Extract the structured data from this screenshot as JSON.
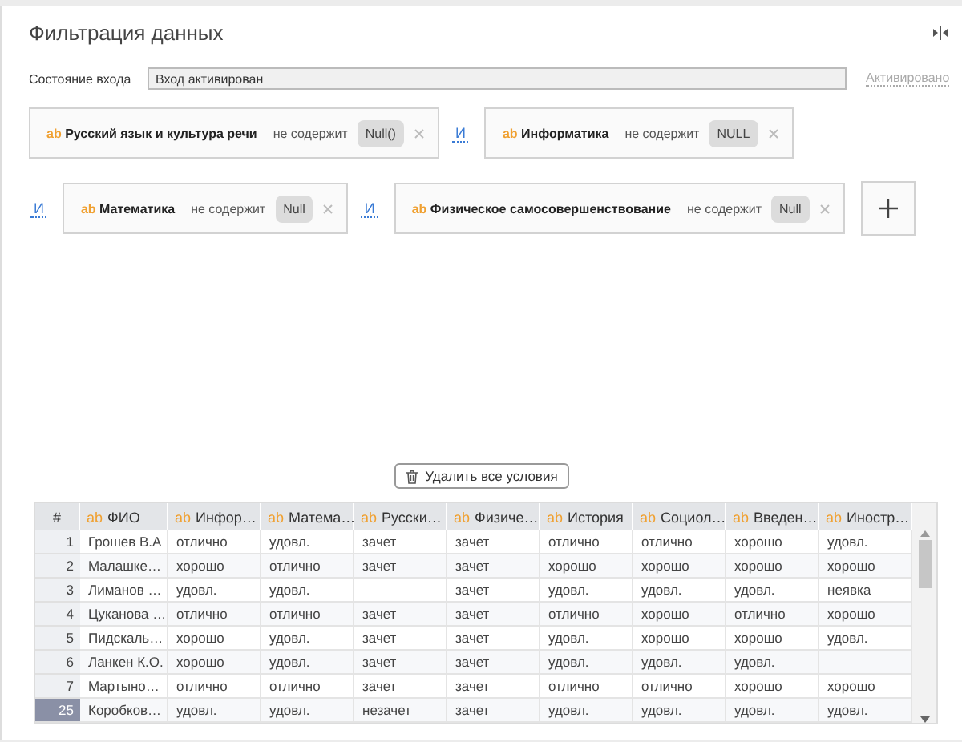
{
  "title": "Фильтрация данных",
  "input_state": {
    "label": "Состояние входа",
    "value": "Вход активирован",
    "status": "Активировано"
  },
  "filter_rows": [
    {
      "items": [
        {
          "type_badge": "ab",
          "field": "Русский язык и культура речи",
          "operator": "не содержит",
          "value": "Null()"
        },
        {
          "connector": "И",
          "type_badge": "ab",
          "field": "Информатика",
          "operator": "не содержит",
          "value": "NULL"
        }
      ]
    },
    {
      "items": [
        {
          "connector": "И",
          "type_badge": "ab",
          "field": "Математика",
          "operator": "не содержит",
          "value": "Null"
        },
        {
          "connector": "И",
          "type_badge": "ab",
          "field": "Физическое самосовершенствование",
          "operator": "не содержит",
          "value": "Null"
        }
      ]
    }
  ],
  "delete_all_button": "Удалить все условия",
  "table": {
    "index_header": "#",
    "columns": [
      {
        "badge": "ab",
        "label": "ФИО"
      },
      {
        "badge": "ab",
        "label": "Инфор…"
      },
      {
        "badge": "ab",
        "label": "Матема…"
      },
      {
        "badge": "ab",
        "label": "Русски…"
      },
      {
        "badge": "ab",
        "label": "Физиче…"
      },
      {
        "badge": "ab",
        "label": "История"
      },
      {
        "badge": "ab",
        "label": "Социол…"
      },
      {
        "badge": "ab",
        "label": "Введен…"
      },
      {
        "badge": "ab",
        "label": "Иностр…"
      }
    ],
    "rows": [
      {
        "index": "1",
        "selected": false,
        "cells": [
          "Грошев В.А",
          "отлично",
          "удовл.",
          "зачет",
          "зачет",
          "отлично",
          "отлично",
          "хорошо",
          "удовл."
        ]
      },
      {
        "index": "2",
        "selected": false,
        "cells": [
          "Малашке…",
          "хорошо",
          "отлично",
          "зачет",
          "зачет",
          "хорошо",
          "хорошо",
          "хорошо",
          "хорошо"
        ]
      },
      {
        "index": "3",
        "selected": false,
        "cells": [
          "Лиманов …",
          "удовл.",
          "удовл.",
          "",
          "зачет",
          "удовл.",
          "удовл.",
          "удовл.",
          "неявка"
        ]
      },
      {
        "index": "4",
        "selected": false,
        "cells": [
          "Цуканова …",
          "отлично",
          "отлично",
          "зачет",
          "зачет",
          "отлично",
          "хорошо",
          "отлично",
          "хорошо"
        ]
      },
      {
        "index": "5",
        "selected": false,
        "cells": [
          "Пидскаль…",
          "хорошо",
          "удовл.",
          "зачет",
          "зачет",
          "удовл.",
          "хорошо",
          "хорошо",
          "удовл."
        ]
      },
      {
        "index": "6",
        "selected": false,
        "cells": [
          "Ланкен К.О.",
          "хорошо",
          "удовл.",
          "зачет",
          "зачет",
          "удовл.",
          "удовл.",
          "удовл.",
          ""
        ]
      },
      {
        "index": "7",
        "selected": false,
        "cells": [
          "Мартыно…",
          "отлично",
          "отлично",
          "зачет",
          "зачет",
          "отлично",
          "отлично",
          "хорошо",
          "хорошо"
        ]
      },
      {
        "index": "25",
        "selected": true,
        "cells": [
          "Коробков…",
          "удовл.",
          "удовл.",
          "незачет",
          "зачет",
          "удовл.",
          "удовл.",
          "удовл.",
          "удовл."
        ]
      }
    ]
  }
}
